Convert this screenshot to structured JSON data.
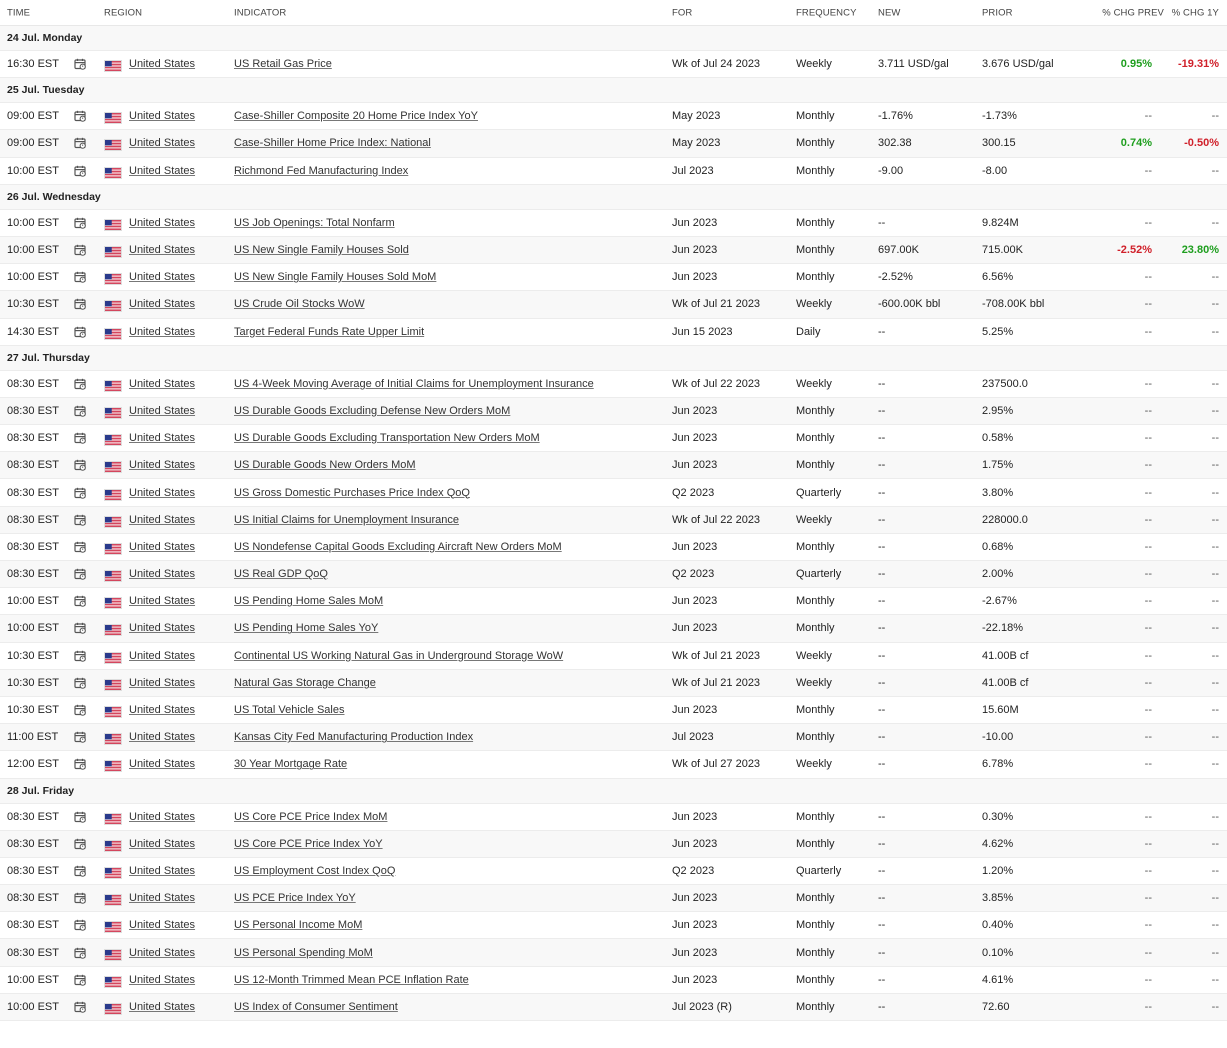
{
  "headers": {
    "time": "TIME",
    "region": "REGION",
    "indicator": "INDICATOR",
    "for": "FOR",
    "frequency": "FREQUENCY",
    "new": "NEW",
    "prior": "PRIOR",
    "chg_prev": "% CHG PREV",
    "chg_1y": "% CHG 1Y"
  },
  "colors": {
    "positive": "#1e9e1e",
    "negative": "#d0202a",
    "row_alt": "#f8f8f8"
  },
  "icons": {
    "reminder": "calendar-reminder-icon",
    "flag": "us-flag-icon"
  },
  "days": [
    {
      "label": "24 Jul. Monday",
      "rows": [
        {
          "time": "16:30 EST",
          "region": "United States",
          "indicator": "US Retail Gas Price",
          "for": "Wk of Jul 24 2023",
          "freq": "Weekly",
          "new": "3.711 USD/gal",
          "prior": "3.676 USD/gal",
          "chg_prev": "0.95%",
          "chg_prev_dir": "pos",
          "chg_1y": "-19.31%",
          "chg_1y_dir": "neg"
        }
      ]
    },
    {
      "label": "25 Jul. Tuesday",
      "rows": [
        {
          "time": "09:00 EST",
          "region": "United States",
          "indicator": "Case-Shiller Composite 20 Home Price Index YoY",
          "for": "May 2023",
          "freq": "Monthly",
          "new": "-1.76%",
          "prior": "-1.73%",
          "chg_prev": "--",
          "chg_prev_dir": "nil",
          "chg_1y": "--",
          "chg_1y_dir": "nil"
        },
        {
          "time": "09:00 EST",
          "region": "United States",
          "indicator": "Case-Shiller Home Price Index: National",
          "for": "May 2023",
          "freq": "Monthly",
          "new": "302.38",
          "prior": "300.15",
          "chg_prev": "0.74%",
          "chg_prev_dir": "pos",
          "chg_1y": "-0.50%",
          "chg_1y_dir": "neg"
        },
        {
          "time": "10:00 EST",
          "region": "United States",
          "indicator": "Richmond Fed Manufacturing Index",
          "for": "Jul 2023",
          "freq": "Monthly",
          "new": "-9.00",
          "prior": "-8.00",
          "chg_prev": "--",
          "chg_prev_dir": "nil",
          "chg_1y": "--",
          "chg_1y_dir": "nil"
        }
      ]
    },
    {
      "label": "26 Jul. Wednesday",
      "rows": [
        {
          "time": "10:00 EST",
          "region": "United States",
          "indicator": "US Job Openings: Total Nonfarm",
          "for": "Jun 2023",
          "freq": "Monthly",
          "new": "--",
          "prior": "9.824M",
          "chg_prev": "--",
          "chg_prev_dir": "nil",
          "chg_1y": "--",
          "chg_1y_dir": "nil"
        },
        {
          "time": "10:00 EST",
          "region": "United States",
          "indicator": "US New Single Family Houses Sold",
          "for": "Jun 2023",
          "freq": "Monthly",
          "new": "697.00K",
          "prior": "715.00K",
          "chg_prev": "-2.52%",
          "chg_prev_dir": "neg",
          "chg_1y": "23.80%",
          "chg_1y_dir": "pos"
        },
        {
          "time": "10:00 EST",
          "region": "United States",
          "indicator": "US New Single Family Houses Sold MoM",
          "for": "Jun 2023",
          "freq": "Monthly",
          "new": "-2.52%",
          "prior": "6.56%",
          "chg_prev": "--",
          "chg_prev_dir": "nil",
          "chg_1y": "--",
          "chg_1y_dir": "nil"
        },
        {
          "time": "10:30 EST",
          "region": "United States",
          "indicator": "US Crude Oil Stocks WoW",
          "for": "Wk of Jul 21 2023",
          "freq": "Weekly",
          "new": "-600.00K bbl",
          "prior": "-708.00K bbl",
          "chg_prev": "--",
          "chg_prev_dir": "nil",
          "chg_1y": "--",
          "chg_1y_dir": "nil"
        },
        {
          "time": "14:30 EST",
          "region": "United States",
          "indicator": "Target Federal Funds Rate Upper Limit",
          "for": "Jun 15 2023",
          "freq": "Daily",
          "new": "--",
          "prior": "5.25%",
          "chg_prev": "--",
          "chg_prev_dir": "nil",
          "chg_1y": "--",
          "chg_1y_dir": "nil"
        }
      ]
    },
    {
      "label": "27 Jul. Thursday",
      "rows": [
        {
          "time": "08:30 EST",
          "region": "United States",
          "indicator": "US 4-Week Moving Average of Initial Claims for Unemployment Insurance",
          "for": "Wk of Jul 22 2023",
          "freq": "Weekly",
          "new": "--",
          "prior": "237500.0",
          "chg_prev": "--",
          "chg_prev_dir": "nil",
          "chg_1y": "--",
          "chg_1y_dir": "nil"
        },
        {
          "time": "08:30 EST",
          "region": "United States",
          "indicator": "US Durable Goods Excluding Defense New Orders MoM",
          "for": "Jun 2023",
          "freq": "Monthly",
          "new": "--",
          "prior": "2.95%",
          "chg_prev": "--",
          "chg_prev_dir": "nil",
          "chg_1y": "--",
          "chg_1y_dir": "nil"
        },
        {
          "time": "08:30 EST",
          "region": "United States",
          "indicator": "US Durable Goods Excluding Transportation New Orders MoM",
          "for": "Jun 2023",
          "freq": "Monthly",
          "new": "--",
          "prior": "0.58%",
          "chg_prev": "--",
          "chg_prev_dir": "nil",
          "chg_1y": "--",
          "chg_1y_dir": "nil"
        },
        {
          "time": "08:30 EST",
          "region": "United States",
          "indicator": "US Durable Goods New Orders MoM",
          "for": "Jun 2023",
          "freq": "Monthly",
          "new": "--",
          "prior": "1.75%",
          "chg_prev": "--",
          "chg_prev_dir": "nil",
          "chg_1y": "--",
          "chg_1y_dir": "nil"
        },
        {
          "time": "08:30 EST",
          "region": "United States",
          "indicator": "US Gross Domestic Purchases Price Index QoQ",
          "for": "Q2 2023",
          "freq": "Quarterly",
          "new": "--",
          "prior": "3.80%",
          "chg_prev": "--",
          "chg_prev_dir": "nil",
          "chg_1y": "--",
          "chg_1y_dir": "nil"
        },
        {
          "time": "08:30 EST",
          "region": "United States",
          "indicator": "US Initial Claims for Unemployment Insurance",
          "for": "Wk of Jul 22 2023",
          "freq": "Weekly",
          "new": "--",
          "prior": "228000.0",
          "chg_prev": "--",
          "chg_prev_dir": "nil",
          "chg_1y": "--",
          "chg_1y_dir": "nil"
        },
        {
          "time": "08:30 EST",
          "region": "United States",
          "indicator": "US Nondefense Capital Goods Excluding Aircraft New Orders MoM",
          "for": "Jun 2023",
          "freq": "Monthly",
          "new": "--",
          "prior": "0.68%",
          "chg_prev": "--",
          "chg_prev_dir": "nil",
          "chg_1y": "--",
          "chg_1y_dir": "nil"
        },
        {
          "time": "08:30 EST",
          "region": "United States",
          "indicator": "US Real GDP QoQ",
          "for": "Q2 2023",
          "freq": "Quarterly",
          "new": "--",
          "prior": "2.00%",
          "chg_prev": "--",
          "chg_prev_dir": "nil",
          "chg_1y": "--",
          "chg_1y_dir": "nil"
        },
        {
          "time": "10:00 EST",
          "region": "United States",
          "indicator": "US Pending Home Sales MoM",
          "for": "Jun 2023",
          "freq": "Monthly",
          "new": "--",
          "prior": "-2.67%",
          "chg_prev": "--",
          "chg_prev_dir": "nil",
          "chg_1y": "--",
          "chg_1y_dir": "nil"
        },
        {
          "time": "10:00 EST",
          "region": "United States",
          "indicator": "US Pending Home Sales YoY",
          "for": "Jun 2023",
          "freq": "Monthly",
          "new": "--",
          "prior": "-22.18%",
          "chg_prev": "--",
          "chg_prev_dir": "nil",
          "chg_1y": "--",
          "chg_1y_dir": "nil"
        },
        {
          "time": "10:30 EST",
          "region": "United States",
          "indicator": "Continental US Working Natural Gas in Underground Storage WoW",
          "for": "Wk of Jul 21 2023",
          "freq": "Weekly",
          "new": "--",
          "prior": "41.00B cf",
          "chg_prev": "--",
          "chg_prev_dir": "nil",
          "chg_1y": "--",
          "chg_1y_dir": "nil"
        },
        {
          "time": "10:30 EST",
          "region": "United States",
          "indicator": "Natural Gas Storage Change",
          "for": "Wk of Jul 21 2023",
          "freq": "Weekly",
          "new": "--",
          "prior": "41.00B cf",
          "chg_prev": "--",
          "chg_prev_dir": "nil",
          "chg_1y": "--",
          "chg_1y_dir": "nil"
        },
        {
          "time": "10:30 EST",
          "region": "United States",
          "indicator": "US Total Vehicle Sales",
          "for": "Jun 2023",
          "freq": "Monthly",
          "new": "--",
          "prior": "15.60M",
          "chg_prev": "--",
          "chg_prev_dir": "nil",
          "chg_1y": "--",
          "chg_1y_dir": "nil"
        },
        {
          "time": "11:00 EST",
          "region": "United States",
          "indicator": "Kansas City Fed Manufacturing Production Index",
          "for": "Jul 2023",
          "freq": "Monthly",
          "new": "--",
          "prior": "-10.00",
          "chg_prev": "--",
          "chg_prev_dir": "nil",
          "chg_1y": "--",
          "chg_1y_dir": "nil"
        },
        {
          "time": "12:00 EST",
          "region": "United States",
          "indicator": "30 Year Mortgage Rate",
          "for": "Wk of Jul 27 2023",
          "freq": "Weekly",
          "new": "--",
          "prior": "6.78%",
          "chg_prev": "--",
          "chg_prev_dir": "nil",
          "chg_1y": "--",
          "chg_1y_dir": "nil"
        }
      ]
    },
    {
      "label": "28 Jul. Friday",
      "rows": [
        {
          "time": "08:30 EST",
          "region": "United States",
          "indicator": "US Core PCE Price Index MoM",
          "for": "Jun 2023",
          "freq": "Monthly",
          "new": "--",
          "prior": "0.30%",
          "chg_prev": "--",
          "chg_prev_dir": "nil",
          "chg_1y": "--",
          "chg_1y_dir": "nil"
        },
        {
          "time": "08:30 EST",
          "region": "United States",
          "indicator": "US Core PCE Price Index YoY",
          "for": "Jun 2023",
          "freq": "Monthly",
          "new": "--",
          "prior": "4.62%",
          "chg_prev": "--",
          "chg_prev_dir": "nil",
          "chg_1y": "--",
          "chg_1y_dir": "nil"
        },
        {
          "time": "08:30 EST",
          "region": "United States",
          "indicator": "US Employment Cost Index QoQ",
          "for": "Q2 2023",
          "freq": "Quarterly",
          "new": "--",
          "prior": "1.20%",
          "chg_prev": "--",
          "chg_prev_dir": "nil",
          "chg_1y": "--",
          "chg_1y_dir": "nil"
        },
        {
          "time": "08:30 EST",
          "region": "United States",
          "indicator": "US PCE Price Index YoY",
          "for": "Jun 2023",
          "freq": "Monthly",
          "new": "--",
          "prior": "3.85%",
          "chg_prev": "--",
          "chg_prev_dir": "nil",
          "chg_1y": "--",
          "chg_1y_dir": "nil"
        },
        {
          "time": "08:30 EST",
          "region": "United States",
          "indicator": "US Personal Income MoM",
          "for": "Jun 2023",
          "freq": "Monthly",
          "new": "--",
          "prior": "0.40%",
          "chg_prev": "--",
          "chg_prev_dir": "nil",
          "chg_1y": "--",
          "chg_1y_dir": "nil"
        },
        {
          "time": "08:30 EST",
          "region": "United States",
          "indicator": "US Personal Spending MoM",
          "for": "Jun 2023",
          "freq": "Monthly",
          "new": "--",
          "prior": "0.10%",
          "chg_prev": "--",
          "chg_prev_dir": "nil",
          "chg_1y": "--",
          "chg_1y_dir": "nil"
        },
        {
          "time": "10:00 EST",
          "region": "United States",
          "indicator": "US 12-Month Trimmed Mean PCE Inflation Rate",
          "for": "Jun 2023",
          "freq": "Monthly",
          "new": "--",
          "prior": "4.61%",
          "chg_prev": "--",
          "chg_prev_dir": "nil",
          "chg_1y": "--",
          "chg_1y_dir": "nil"
        },
        {
          "time": "10:00 EST",
          "region": "United States",
          "indicator": "US Index of Consumer Sentiment",
          "for": "Jul 2023 (R)",
          "freq": "Monthly",
          "new": "--",
          "prior": "72.60",
          "chg_prev": "--",
          "chg_prev_dir": "nil",
          "chg_1y": "--",
          "chg_1y_dir": "nil"
        }
      ]
    }
  ]
}
